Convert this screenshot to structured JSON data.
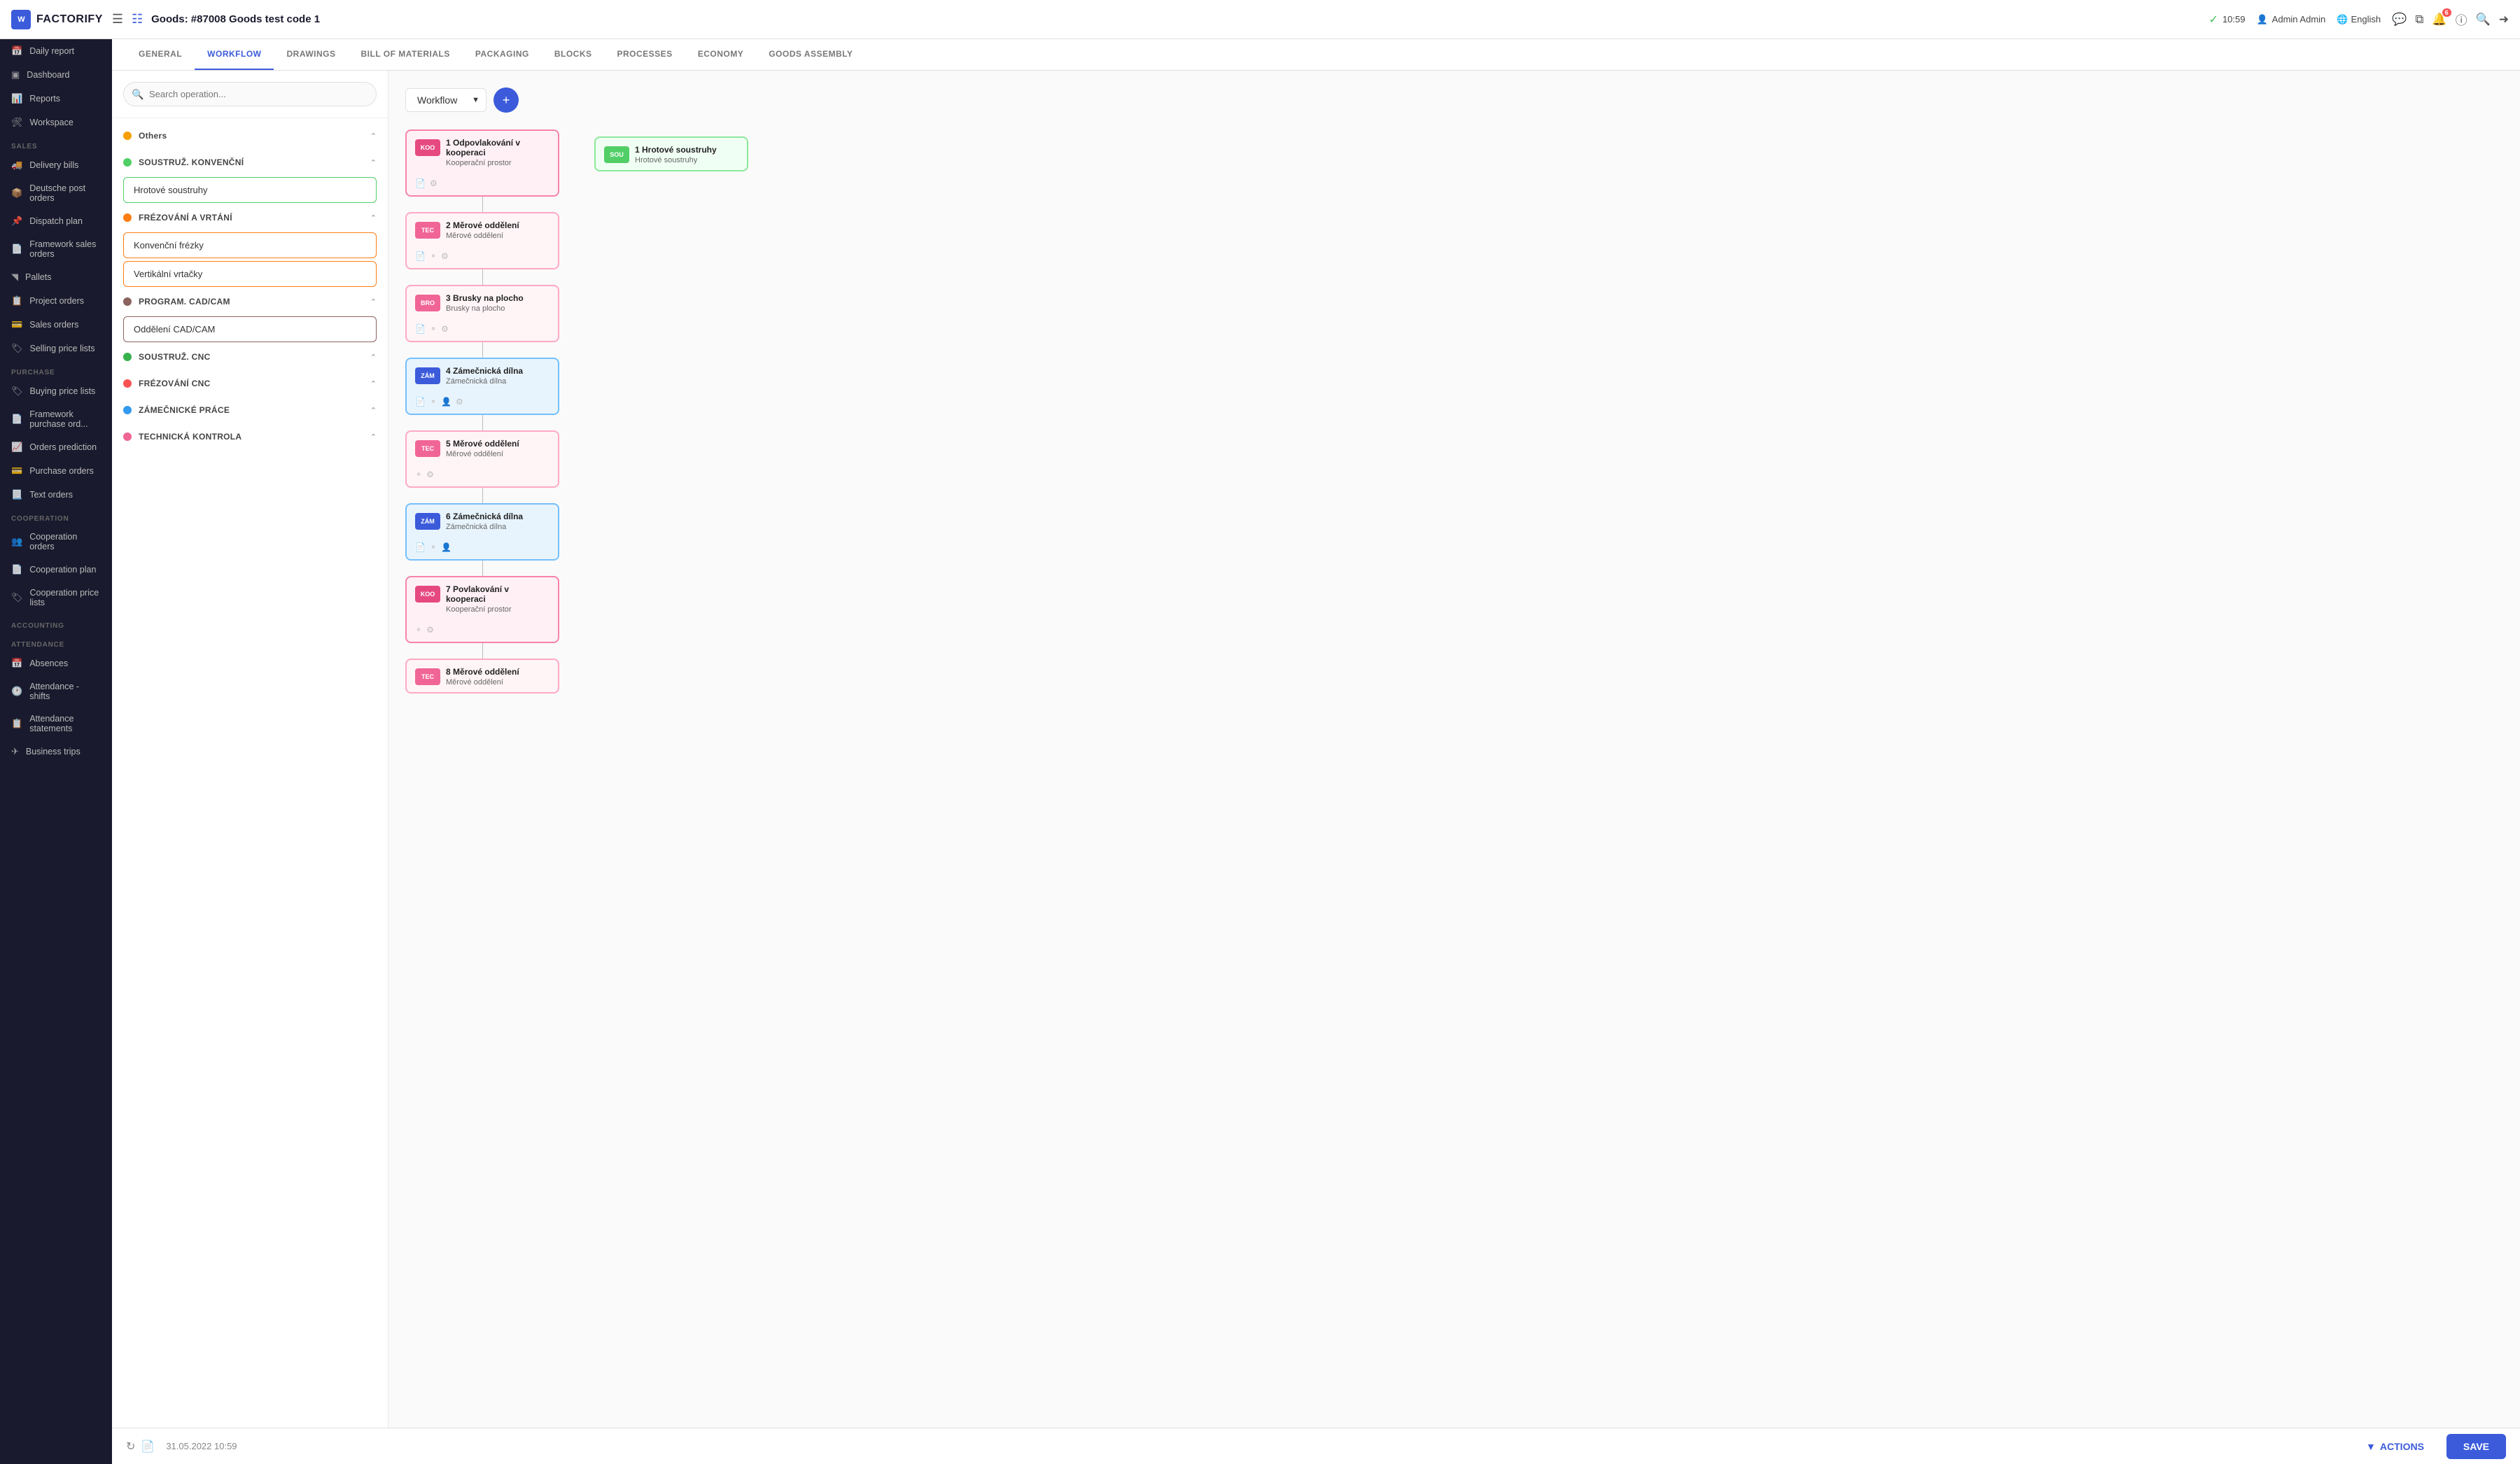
{
  "app": {
    "logo": "W",
    "name": "FACTORIFY"
  },
  "topbar": {
    "page_title": "Goods: #87008 Goods test code 1",
    "time": "10:59",
    "user": "Admin Admin",
    "language": "English"
  },
  "tabs": [
    {
      "id": "general",
      "label": "GENERAL"
    },
    {
      "id": "workflow",
      "label": "WORKFLOW",
      "active": true
    },
    {
      "id": "drawings",
      "label": "DRAWINGS"
    },
    {
      "id": "bom",
      "label": "BILL OF MATERIALS"
    },
    {
      "id": "packaging",
      "label": "PACKAGING"
    },
    {
      "id": "blocks",
      "label": "BLOCKS"
    },
    {
      "id": "processes",
      "label": "PROCESSES"
    },
    {
      "id": "economy",
      "label": "ECONOMY"
    },
    {
      "id": "goods_assembly",
      "label": "GOODS ASSEMBLY"
    }
  ],
  "sidebar": {
    "sales_label": "SALES",
    "purchase_label": "PURCHASE",
    "cooperation_label": "COOPERATION",
    "accounting_label": "ACCOUNTING",
    "attendance_label": "ATTENDANCE",
    "items": [
      {
        "id": "daily_report",
        "label": "Daily report"
      },
      {
        "id": "dashboard",
        "label": "Dashboard"
      },
      {
        "id": "reports",
        "label": "Reports"
      },
      {
        "id": "workspace",
        "label": "Workspace"
      },
      {
        "id": "delivery_bills",
        "label": "Delivery bills"
      },
      {
        "id": "deutsche_post",
        "label": "Deutsche post orders"
      },
      {
        "id": "dispatch_plan",
        "label": "Dispatch plan"
      },
      {
        "id": "framework_sales",
        "label": "Framework sales orders"
      },
      {
        "id": "pallets",
        "label": "Pallets"
      },
      {
        "id": "project_orders",
        "label": "Project orders"
      },
      {
        "id": "sales_orders",
        "label": "Sales orders"
      },
      {
        "id": "selling_price",
        "label": "Selling price lists"
      },
      {
        "id": "buying_price",
        "label": "Buying price lists"
      },
      {
        "id": "framework_purchase",
        "label": "Framework purchase ord..."
      },
      {
        "id": "orders_prediction",
        "label": "Orders prediction"
      },
      {
        "id": "purchase_orders",
        "label": "Purchase orders"
      },
      {
        "id": "text_orders",
        "label": "Text orders"
      },
      {
        "id": "cooperation_orders",
        "label": "Cooperation orders"
      },
      {
        "id": "cooperation_plan",
        "label": "Cooperation plan"
      },
      {
        "id": "cooperation_price",
        "label": "Cooperation price lists"
      },
      {
        "id": "absences",
        "label": "Absences"
      },
      {
        "id": "attendance_shifts",
        "label": "Attendance - shifts"
      },
      {
        "id": "attendance_statements",
        "label": "Attendance statements"
      },
      {
        "id": "business_trips",
        "label": "Business trips"
      }
    ]
  },
  "search": {
    "placeholder": "Search operation..."
  },
  "workflow": {
    "select_value": "Workflow",
    "groups": [
      {
        "id": "others",
        "label": "Others",
        "dot": "yellow",
        "expanded": true,
        "items": []
      },
      {
        "id": "soust_konv",
        "label": "SOUSTRUŽ. KONVENČNÍ",
        "dot": "green",
        "expanded": true,
        "items": [
          "Hrotové soustruhy"
        ]
      },
      {
        "id": "frezovani",
        "label": "FRÉZOVÁNÍ A VRTÁNÍ",
        "dot": "orange",
        "expanded": true,
        "items": [
          "Konvenční frézky",
          "Vertikální vrtačky"
        ]
      },
      {
        "id": "cad_cam",
        "label": "PROGRAM. CAD/CAM",
        "dot": "brown",
        "expanded": true,
        "items": [
          "Oddělení CAD/CAM"
        ]
      },
      {
        "id": "soust_cnc",
        "label": "SOUSTRUŽ. CNC",
        "dot": "green2",
        "expanded": true,
        "items": []
      },
      {
        "id": "frezovani_cnc",
        "label": "FRÉZOVÁNÍ CNC",
        "dot": "red",
        "expanded": true,
        "items": []
      },
      {
        "id": "zamecnicke",
        "label": "ZÁMEČNICKÉ PRÁCE",
        "dot": "blue",
        "expanded": true,
        "items": []
      },
      {
        "id": "technicka",
        "label": "TECHNICKÁ KONTROLA",
        "dot": "pink",
        "expanded": true,
        "items": []
      }
    ],
    "nodes": [
      {
        "id": 1,
        "num": "1",
        "label_code": "KOO",
        "label_class": "label-koo",
        "name": "Odpovlakování v kooperaci",
        "sub": "Kooperační prostor",
        "node_class": "node-pink",
        "icons": [
          "file",
          "settings"
        ]
      },
      {
        "id": 2,
        "num": "2",
        "label_code": "TEC",
        "label_class": "label-tec",
        "name": "Měrové oddělení",
        "sub": "Měrové oddělení",
        "node_class": "node-pink-light",
        "icons": [
          "file",
          "clock",
          "settings"
        ]
      },
      {
        "id": 3,
        "num": "3",
        "label_code": "BRO",
        "label_class": "label-bro",
        "name": "Brusky na plocho",
        "sub": "Brusky na plocho",
        "node_class": "node-pink-light",
        "icons": [
          "file",
          "clock",
          "settings"
        ]
      },
      {
        "id": 4,
        "num": "4",
        "label_code": "ZÁM",
        "label_class": "label-zam",
        "name": "Zámečnická dílna",
        "sub": "Zámečnická dílna",
        "node_class": "node-blue",
        "icons": [
          "file",
          "clock",
          "person",
          "settings"
        ]
      },
      {
        "id": 5,
        "num": "5",
        "label_code": "TEC",
        "label_class": "label-tec",
        "name": "Měrové oddělení",
        "sub": "Měrové oddělení",
        "node_class": "node-pink-light",
        "icons": [
          "clock",
          "settings"
        ]
      },
      {
        "id": 6,
        "num": "6",
        "label_code": "ZÁM",
        "label_class": "label-zam",
        "name": "Zámečnická dílna",
        "sub": "Zámečnická dílna",
        "node_class": "node-blue",
        "icons": [
          "file",
          "clock",
          "person"
        ]
      },
      {
        "id": 7,
        "num": "7",
        "label_code": "KOO",
        "label_class": "label-koo",
        "name": "Povlakování v kooperaci",
        "sub": "Kooperační prostor",
        "node_class": "node-pink",
        "icons": [
          "clock",
          "settings"
        ]
      },
      {
        "id": 8,
        "num": "8",
        "label_code": "TEC",
        "label_class": "label-tec",
        "name": "Měrové oddělení",
        "sub": "Měrové oddělení",
        "node_class": "node-pink-light",
        "icons": []
      }
    ],
    "side_node": {
      "id": "s1",
      "num": "",
      "label_code": "SOU",
      "label_class": "label-sou",
      "name": "1 Hrotové soustruhy",
      "sub": "Hrotové soustruhy",
      "node_class": "node-green",
      "icons": []
    }
  },
  "bottom": {
    "timestamp": "31.05.2022 10:59",
    "actions_label": "ACTIONS",
    "save_label": "SAVE"
  }
}
